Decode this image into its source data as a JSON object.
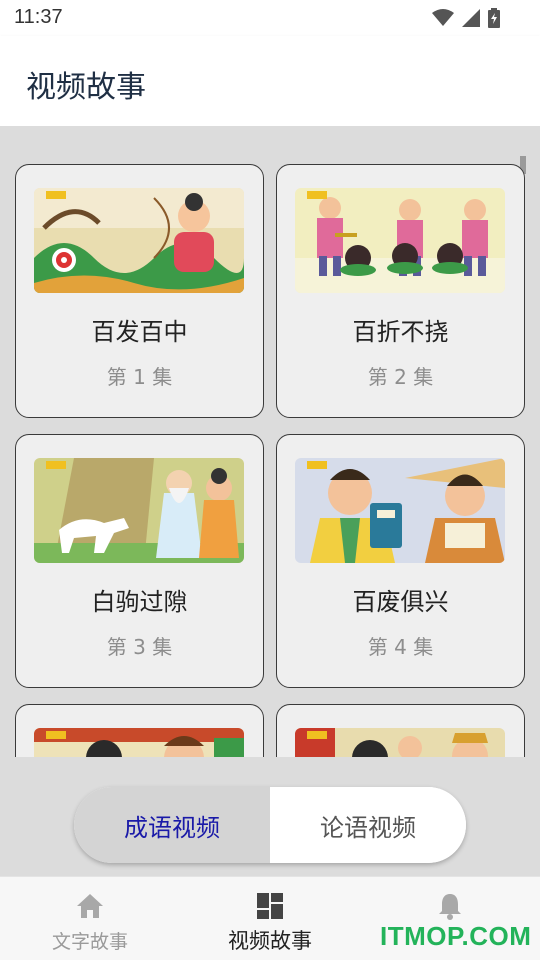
{
  "status_bar": {
    "time": "11:37"
  },
  "app_bar": {
    "title": "视频故事"
  },
  "cards": [
    {
      "title": "百发百中",
      "episode": "第 1 集"
    },
    {
      "title": "百折不挠",
      "episode": "第 2 集"
    },
    {
      "title": "白驹过隙",
      "episode": "第 3 集"
    },
    {
      "title": "百废俱兴",
      "episode": "第 4 集"
    },
    {
      "title": "",
      "episode": ""
    },
    {
      "title": "",
      "episode": ""
    }
  ],
  "segmented": {
    "left_label": "成语视频",
    "right_label": "论语视频",
    "selected": "成语视频"
  },
  "bottom_nav": [
    {
      "label": "文字故事",
      "icon": "home-icon",
      "active": false
    },
    {
      "label": "视频故事",
      "icon": "dashboard-icon",
      "active": true
    },
    {
      "label": "",
      "icon": "bell-icon",
      "active": false
    }
  ],
  "watermark": "ITMOP.COM",
  "colors": {
    "accent_text": "#1a1aa8",
    "watermark": "#23b35a",
    "title": "#1f2f44"
  }
}
